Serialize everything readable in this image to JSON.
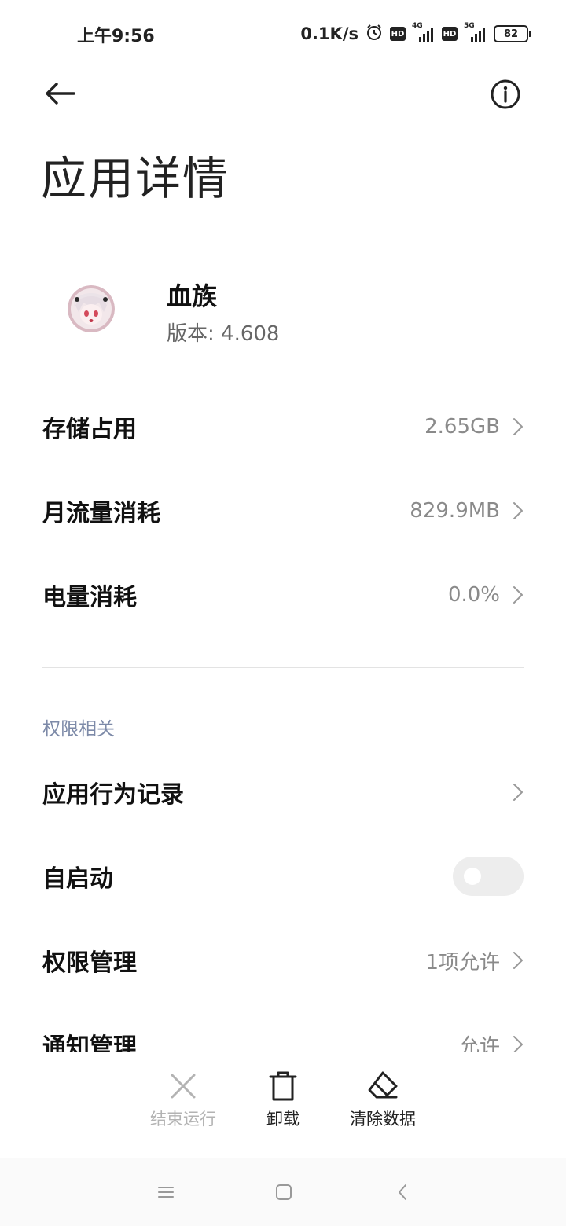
{
  "status_bar": {
    "time": "上午9:56",
    "net_speed": "0.1K/s",
    "hd_badge": "HD",
    "sim1_gen": "4G",
    "sim2_gen": "5G",
    "battery": "82"
  },
  "header": {
    "back_icon": "arrow-left-icon",
    "info_icon": "info-circle-icon",
    "title": "应用详情"
  },
  "app": {
    "name": "血族",
    "version": "版本: 4.608",
    "icon": "anime-avatar-icon"
  },
  "usage_rows": [
    {
      "label": "存储占用",
      "value": "2.65GB"
    },
    {
      "label": "月流量消耗",
      "value": "829.9MB"
    },
    {
      "label": "电量消耗",
      "value": "0.0%"
    }
  ],
  "permissions": {
    "section_title": "权限相关",
    "behavior_log": {
      "label": "应用行为记录"
    },
    "autostart": {
      "label": "自启动",
      "enabled": false
    },
    "permission_mgmt": {
      "label": "权限管理",
      "value": "1项允许"
    },
    "notification_mgmt": {
      "label": "通知管理",
      "value": "允许"
    }
  },
  "actions": [
    {
      "label": "结束运行",
      "icon": "close-x-icon",
      "enabled": false
    },
    {
      "label": "卸载",
      "icon": "trash-icon",
      "enabled": true
    },
    {
      "label": "清除数据",
      "icon": "eraser-icon",
      "enabled": true
    }
  ],
  "nav_bar": {
    "icons": [
      "menu-icon",
      "home-square-icon",
      "back-chevron-icon"
    ]
  },
  "colors": {
    "section_label": "#7d8aa8",
    "value_text": "#8a8a8a",
    "disabled_text": "#b3b3b3",
    "toggle_off": "#ededed"
  }
}
